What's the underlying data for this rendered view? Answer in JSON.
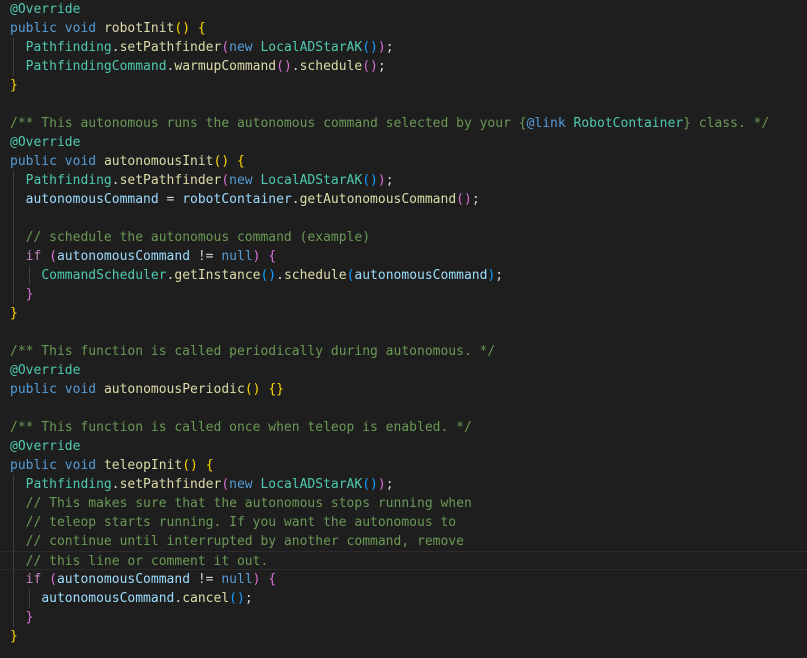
{
  "editor": {
    "colors": {
      "background": "#1e1e1e",
      "keyword": "#569cd6",
      "control": "#c586c0",
      "type": "#4ec9b0",
      "function": "#dcdcaa",
      "variable": "#9cdcfe",
      "comment": "#6a9955",
      "bracket1": "#ffd700",
      "bracket2": "#da70d6",
      "bracket3": "#179fff"
    },
    "current_line": 29,
    "lines": [
      {
        "indent": 0,
        "tokens": [
          {
            "t": "@Override",
            "c": "ann"
          }
        ]
      },
      {
        "indent": 0,
        "tokens": [
          {
            "t": "public",
            "c": "kw"
          },
          {
            "t": " ",
            "c": "plain"
          },
          {
            "t": "void",
            "c": "kw"
          },
          {
            "t": " ",
            "c": "plain"
          },
          {
            "t": "robotInit",
            "c": "fn"
          },
          {
            "t": "()",
            "c": "b1"
          },
          {
            "t": " ",
            "c": "plain"
          },
          {
            "t": "{",
            "c": "b1"
          }
        ]
      },
      {
        "indent": 1,
        "tokens": [
          {
            "t": "Pathfinding",
            "c": "cls"
          },
          {
            "t": ".",
            "c": "plain"
          },
          {
            "t": "setPathfinder",
            "c": "fn"
          },
          {
            "t": "(",
            "c": "b2"
          },
          {
            "t": "new",
            "c": "kw"
          },
          {
            "t": " ",
            "c": "plain"
          },
          {
            "t": "LocalADStarAK",
            "c": "cls"
          },
          {
            "t": "()",
            "c": "b3"
          },
          {
            "t": ")",
            "c": "b2"
          },
          {
            "t": ";",
            "c": "plain"
          }
        ]
      },
      {
        "indent": 1,
        "tokens": [
          {
            "t": "PathfindingCommand",
            "c": "cls"
          },
          {
            "t": ".",
            "c": "plain"
          },
          {
            "t": "warmupCommand",
            "c": "fn"
          },
          {
            "t": "()",
            "c": "b2"
          },
          {
            "t": ".",
            "c": "plain"
          },
          {
            "t": "schedule",
            "c": "fn"
          },
          {
            "t": "()",
            "c": "b2"
          },
          {
            "t": ";",
            "c": "plain"
          }
        ]
      },
      {
        "indent": 0,
        "tokens": [
          {
            "t": "}",
            "c": "b1"
          }
        ]
      },
      {
        "indent": 0,
        "tokens": []
      },
      {
        "indent": 0,
        "tokens": [
          {
            "t": "/** This autonomous runs the autonomous command selected by your {",
            "c": "cmt"
          },
          {
            "t": "@link",
            "c": "kw"
          },
          {
            "t": " ",
            "c": "cmt"
          },
          {
            "t": "RobotContainer",
            "c": "doc"
          },
          {
            "t": "} class. */",
            "c": "cmt"
          }
        ]
      },
      {
        "indent": 0,
        "tokens": [
          {
            "t": "@Override",
            "c": "ann"
          }
        ]
      },
      {
        "indent": 0,
        "tokens": [
          {
            "t": "public",
            "c": "kw"
          },
          {
            "t": " ",
            "c": "plain"
          },
          {
            "t": "void",
            "c": "kw"
          },
          {
            "t": " ",
            "c": "plain"
          },
          {
            "t": "autonomousInit",
            "c": "fn"
          },
          {
            "t": "()",
            "c": "b1"
          },
          {
            "t": " ",
            "c": "plain"
          },
          {
            "t": "{",
            "c": "b1"
          }
        ]
      },
      {
        "indent": 1,
        "tokens": [
          {
            "t": "Pathfinding",
            "c": "cls"
          },
          {
            "t": ".",
            "c": "plain"
          },
          {
            "t": "setPathfinder",
            "c": "fn"
          },
          {
            "t": "(",
            "c": "b2"
          },
          {
            "t": "new",
            "c": "kw"
          },
          {
            "t": " ",
            "c": "plain"
          },
          {
            "t": "LocalADStarAK",
            "c": "cls"
          },
          {
            "t": "()",
            "c": "b3"
          },
          {
            "t": ")",
            "c": "b2"
          },
          {
            "t": ";",
            "c": "plain"
          }
        ]
      },
      {
        "indent": 1,
        "tokens": [
          {
            "t": "autonomousCommand",
            "c": "var"
          },
          {
            "t": " = ",
            "c": "plain"
          },
          {
            "t": "robotContainer",
            "c": "var"
          },
          {
            "t": ".",
            "c": "plain"
          },
          {
            "t": "getAutonomousCommand",
            "c": "fn"
          },
          {
            "t": "()",
            "c": "b2"
          },
          {
            "t": ";",
            "c": "plain"
          }
        ]
      },
      {
        "indent": 1,
        "tokens": []
      },
      {
        "indent": 1,
        "tokens": [
          {
            "t": "// schedule the autonomous command (example)",
            "c": "cmt"
          }
        ]
      },
      {
        "indent": 1,
        "tokens": [
          {
            "t": "if",
            "c": "ctl"
          },
          {
            "t": " ",
            "c": "plain"
          },
          {
            "t": "(",
            "c": "b2"
          },
          {
            "t": "autonomousCommand",
            "c": "var"
          },
          {
            "t": " != ",
            "c": "plain"
          },
          {
            "t": "null",
            "c": "kw"
          },
          {
            "t": ")",
            "c": "b2"
          },
          {
            "t": " ",
            "c": "plain"
          },
          {
            "t": "{",
            "c": "b2"
          }
        ]
      },
      {
        "indent": 2,
        "tokens": [
          {
            "t": "CommandScheduler",
            "c": "cls"
          },
          {
            "t": ".",
            "c": "plain"
          },
          {
            "t": "getInstance",
            "c": "fn"
          },
          {
            "t": "()",
            "c": "b3"
          },
          {
            "t": ".",
            "c": "plain"
          },
          {
            "t": "schedule",
            "c": "fn"
          },
          {
            "t": "(",
            "c": "b3"
          },
          {
            "t": "autonomousCommand",
            "c": "var"
          },
          {
            "t": ")",
            "c": "b3"
          },
          {
            "t": ";",
            "c": "plain"
          }
        ]
      },
      {
        "indent": 1,
        "tokens": [
          {
            "t": "}",
            "c": "b2"
          }
        ]
      },
      {
        "indent": 0,
        "tokens": [
          {
            "t": "}",
            "c": "b1"
          }
        ]
      },
      {
        "indent": 0,
        "tokens": []
      },
      {
        "indent": 0,
        "tokens": [
          {
            "t": "/** This function is called periodically during autonomous. */",
            "c": "cmt"
          }
        ]
      },
      {
        "indent": 0,
        "tokens": [
          {
            "t": "@Override",
            "c": "ann"
          }
        ]
      },
      {
        "indent": 0,
        "tokens": [
          {
            "t": "public",
            "c": "kw"
          },
          {
            "t": " ",
            "c": "plain"
          },
          {
            "t": "void",
            "c": "kw"
          },
          {
            "t": " ",
            "c": "plain"
          },
          {
            "t": "autonomousPeriodic",
            "c": "fn"
          },
          {
            "t": "()",
            "c": "b1"
          },
          {
            "t": " ",
            "c": "plain"
          },
          {
            "t": "{}",
            "c": "b1"
          }
        ]
      },
      {
        "indent": 0,
        "tokens": []
      },
      {
        "indent": 0,
        "tokens": [
          {
            "t": "/** This function is called once when teleop is enabled. */",
            "c": "cmt"
          }
        ]
      },
      {
        "indent": 0,
        "tokens": [
          {
            "t": "@Override",
            "c": "ann"
          }
        ]
      },
      {
        "indent": 0,
        "tokens": [
          {
            "t": "public",
            "c": "kw"
          },
          {
            "t": " ",
            "c": "plain"
          },
          {
            "t": "void",
            "c": "kw"
          },
          {
            "t": " ",
            "c": "plain"
          },
          {
            "t": "teleopInit",
            "c": "fn"
          },
          {
            "t": "()",
            "c": "b1"
          },
          {
            "t": " ",
            "c": "plain"
          },
          {
            "t": "{",
            "c": "b1"
          }
        ]
      },
      {
        "indent": 1,
        "tokens": [
          {
            "t": "Pathfinding",
            "c": "cls"
          },
          {
            "t": ".",
            "c": "plain"
          },
          {
            "t": "setPathfinder",
            "c": "fn"
          },
          {
            "t": "(",
            "c": "b2"
          },
          {
            "t": "new",
            "c": "kw"
          },
          {
            "t": " ",
            "c": "plain"
          },
          {
            "t": "LocalADStarAK",
            "c": "cls"
          },
          {
            "t": "()",
            "c": "b3"
          },
          {
            "t": ")",
            "c": "b2"
          },
          {
            "t": ";",
            "c": "plain"
          }
        ]
      },
      {
        "indent": 1,
        "tokens": [
          {
            "t": "// This makes sure that the autonomous stops running when",
            "c": "cmt"
          }
        ]
      },
      {
        "indent": 1,
        "tokens": [
          {
            "t": "// teleop starts running. If you want the autonomous to",
            "c": "cmt"
          }
        ]
      },
      {
        "indent": 1,
        "tokens": [
          {
            "t": "// continue until interrupted by another command, remove",
            "c": "cmt"
          }
        ]
      },
      {
        "indent": 1,
        "tokens": [
          {
            "t": "// this line or comment it out.",
            "c": "cmt"
          }
        ]
      },
      {
        "indent": 1,
        "tokens": [
          {
            "t": "if",
            "c": "ctl"
          },
          {
            "t": " ",
            "c": "plain"
          },
          {
            "t": "(",
            "c": "b2"
          },
          {
            "t": "autonomousCommand",
            "c": "var"
          },
          {
            "t": " != ",
            "c": "plain"
          },
          {
            "t": "null",
            "c": "kw"
          },
          {
            "t": ")",
            "c": "b2"
          },
          {
            "t": " ",
            "c": "plain"
          },
          {
            "t": "{",
            "c": "b2"
          }
        ]
      },
      {
        "indent": 2,
        "tokens": [
          {
            "t": "autonomousCommand",
            "c": "var"
          },
          {
            "t": ".",
            "c": "plain"
          },
          {
            "t": "cancel",
            "c": "fn"
          },
          {
            "t": "()",
            "c": "b3"
          },
          {
            "t": ";",
            "c": "plain"
          }
        ]
      },
      {
        "indent": 1,
        "tokens": [
          {
            "t": "}",
            "c": "b2"
          }
        ]
      },
      {
        "indent": 0,
        "tokens": [
          {
            "t": "}",
            "c": "b1"
          }
        ]
      }
    ]
  }
}
